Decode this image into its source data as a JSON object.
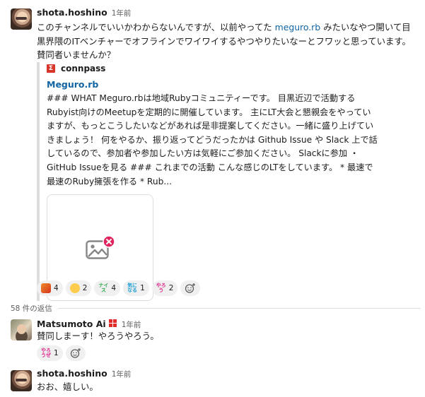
{
  "message_main": {
    "author": "shota.hoshino",
    "time": "1年前",
    "text_before_link": "このチャンネルでいいかわからないんですが、以前やってた ",
    "link_text": "meguro.rb",
    "text_after_link": " みたいなやつ開いて目黒界隈のITベンチャーでオフラインでワイワイするやつやりたいなーとフワッと思っています。賛同者いませんか？"
  },
  "attachment": {
    "service_name": "connpass",
    "service_icon": "connpass-icon",
    "title": "Meguro.rb",
    "description": "### WHAT Meguro.rbは地域Rubyコミュニティーです。 目黒近辺で活動するRubyist向けのMeetupを定期的に開催しています。 主にLT大会と懇親会をやっていますが、もっとこうしたいなどがあれば是非提案してください。一緒に盛り上げていきましょう！ 何をやるか、振り返ってどうだったかは Github Issue や Slack 上で話しているので、参加者や参加したい方は気軽にご参加ください。 Slackに参加 ・ GitHub Issueを見る ### これまでの活動 こんな感じのLTをしています。 * 最速で最速のRuby擁張を作る * Rub...",
    "image_icon": "broken-image-icon"
  },
  "reactions_main": [
    {
      "emoji": "fire-icon",
      "count": "4"
    },
    {
      "emoji": "raised-hands-icon",
      "count": "2"
    },
    {
      "emoji": "nice-icon",
      "count": "4"
    },
    {
      "emoji": "kininaru-icon",
      "count": "1"
    },
    {
      "emoji": "yarou-icon",
      "count": "2"
    }
  ],
  "thread_divider": "58 件の返信",
  "reply_1": {
    "author": "Matsumoto Ai",
    "status_emoji": "status-badge-icon",
    "time": "1年前",
    "text": "賛同しまーす！やろうやろう。",
    "reactions": [
      {
        "emoji": "yarou-icon",
        "count": "1"
      }
    ]
  },
  "reply_2": {
    "author": "shota.hoshino",
    "time": "1年前",
    "text": "おお、嬉しい。"
  },
  "colors": {
    "link": "#1264a3",
    "connpass": "#d8352a",
    "reaction_bg": "#f0f0f0",
    "broken_badge": "#e0245e"
  }
}
